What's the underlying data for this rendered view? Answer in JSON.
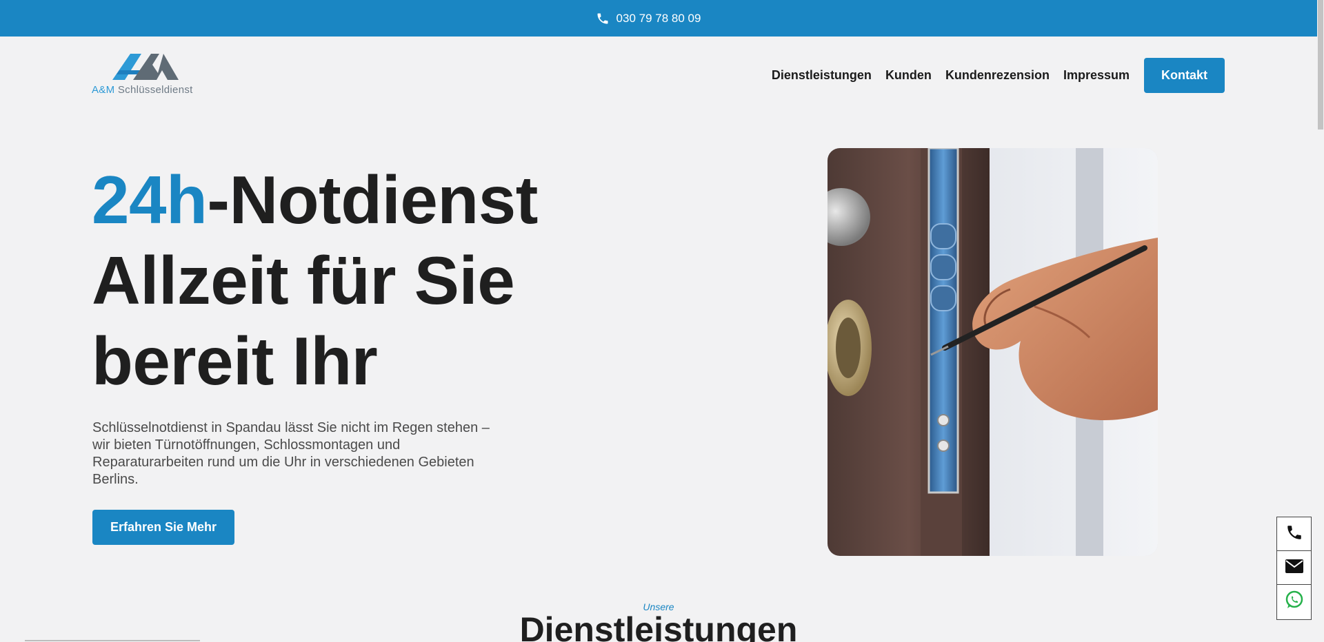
{
  "topbar": {
    "phone": "030 79 78 80 09",
    "icon": "phone-icon"
  },
  "logo": {
    "am": "A&M",
    "rest": "Schlüsseldienst"
  },
  "nav": {
    "items": [
      "Dienstleistungen",
      "Kunden",
      "Kundenrezension",
      "Impressum"
    ],
    "contact": "Kontakt"
  },
  "hero": {
    "title_accent": "24h",
    "title_line1_rest": "-Notdienst",
    "title_line2": "Allzeit für Sie",
    "title_line3": "bereit Ihr",
    "text": "Schlüsselnotdienst in Spandau lässt Sie nicht im Regen stehen – wir bieten Türnotöffnungen, Schlossmontagen und Reparaturarbeiten rund um die Uhr in verschiedenen Gebieten Berlins.",
    "cta": "Erfahren Sie Mehr"
  },
  "section": {
    "subtitle": "Unsere",
    "title": "Dienstleistungen"
  },
  "floating_actions": [
    "phone-icon",
    "mail-icon",
    "whatsapp-icon"
  ],
  "colors": {
    "accent": "#1a86c3",
    "background": "#f2f2f3",
    "text": "#1f1f1f"
  }
}
